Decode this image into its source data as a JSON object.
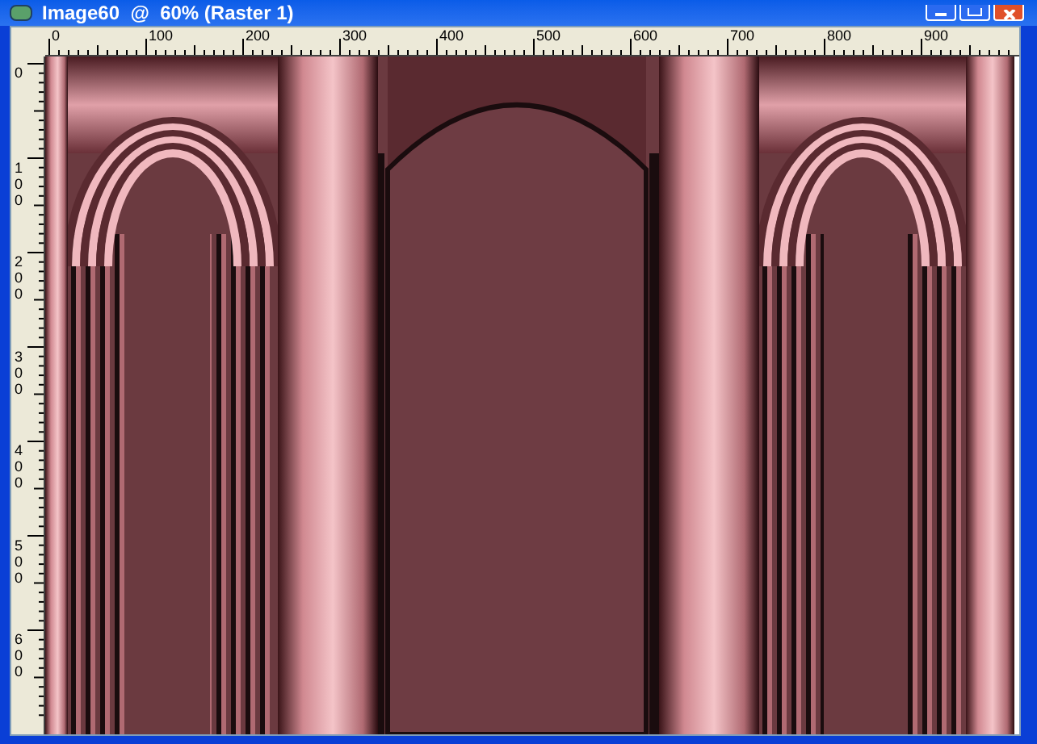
{
  "window": {
    "title": "Image60  @  60% (Raster 1)"
  },
  "ruler_horizontal": [
    "0",
    "100",
    "200",
    "300",
    "400",
    "500",
    "600",
    "700",
    "800",
    "900"
  ],
  "ruler_vertical": [
    "0",
    "100",
    "200",
    "300",
    "400",
    "500",
    "600"
  ]
}
